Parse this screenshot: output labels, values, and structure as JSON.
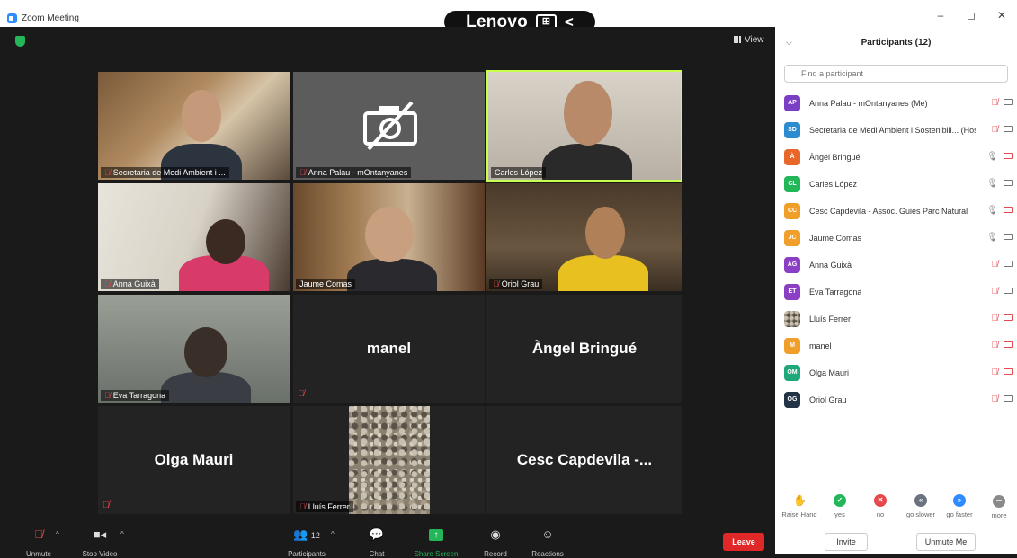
{
  "window": {
    "title": "Zoom Meeting",
    "controls": [
      "–",
      "◻",
      "✕"
    ]
  },
  "overlay": {
    "brand": "Lenovo",
    "grid_symbol": "⊞",
    "arrow": "<"
  },
  "meeting": {
    "view_label": "View",
    "tiles": [
      {
        "name": "Secretaria de Medi Ambient i ...",
        "muted": true,
        "kind": "video"
      },
      {
        "name": "Anna Palau - mOntanyanes",
        "muted": true,
        "kind": "camera-off"
      },
      {
        "name": "Carles López",
        "muted": false,
        "kind": "video",
        "active": true
      },
      {
        "name": "Anna Guixà",
        "muted": true,
        "kind": "video"
      },
      {
        "name": "Jaume Comas",
        "muted": false,
        "kind": "video"
      },
      {
        "name": "Oriol Grau",
        "muted": true,
        "kind": "video"
      },
      {
        "name": "Eva Tarragona",
        "muted": true,
        "kind": "video"
      },
      {
        "name": "manel",
        "muted": true,
        "kind": "name-only"
      },
      {
        "name": "Àngel Bringué",
        "muted": false,
        "kind": "name-only"
      },
      {
        "name": "Olga Mauri",
        "muted": true,
        "kind": "name-only"
      },
      {
        "name": "Lluís Ferrer",
        "muted": true,
        "kind": "image"
      },
      {
        "name": "Cesc Capdevila -...",
        "muted": false,
        "kind": "name-only"
      }
    ]
  },
  "toolbar": {
    "unmute": "Unmute",
    "stop_video": "Stop Video",
    "participants": "Participants",
    "participants_count": "12",
    "chat": "Chat",
    "share_screen": "Share Screen",
    "record": "Record",
    "reactions": "Reactions",
    "leave": "Leave"
  },
  "panel": {
    "title": "Participants (12)",
    "search_placeholder": "Find a participant",
    "participants": [
      {
        "initials": "AP",
        "name": "Anna Palau - mOntanyanes (Me)",
        "color": "#7b3fc4",
        "mic": "off",
        "cam": "on"
      },
      {
        "initials": "SD",
        "name": "Secretaria de Medi Ambient i Sostenibili... (Host)",
        "color": "#2d8ccf",
        "mic": "off",
        "cam": "on"
      },
      {
        "initials": "À",
        "name": "Àngel Bringué",
        "color": "#e8672a",
        "mic": "on",
        "cam": "off"
      },
      {
        "initials": "CL",
        "name": "Carles López",
        "color": "#23b75a",
        "mic": "on",
        "cam": "on"
      },
      {
        "initials": "CC",
        "name": "Cesc Capdevila - Assoc. Guies Parc Natural",
        "color": "#f0a02a",
        "mic": "on",
        "cam": "off"
      },
      {
        "initials": "JC",
        "name": "Jaume Comas",
        "color": "#f0a02a",
        "mic": "on",
        "cam": "on"
      },
      {
        "initials": "AG",
        "name": "Anna Guixà",
        "color": "#8b3fc4",
        "mic": "off",
        "cam": "on"
      },
      {
        "initials": "ET",
        "name": "Eva Tarragona",
        "color": "#8b3fc4",
        "mic": "off",
        "cam": "on"
      },
      {
        "initials": "",
        "name": "Lluís Ferrer",
        "color": "#9a9080",
        "mic": "off",
        "cam": "off"
      },
      {
        "initials": "M",
        "name": "manel",
        "color": "#f0a02a",
        "mic": "off",
        "cam": "off"
      },
      {
        "initials": "OM",
        "name": "Olga Mauri",
        "color": "#1fa87a",
        "mic": "off",
        "cam": "off"
      },
      {
        "initials": "OG",
        "name": "Oriol Grau",
        "color": "#243447",
        "mic": "off",
        "cam": "on"
      }
    ],
    "reactions": [
      {
        "label": "Raise Hand",
        "icon": "✋",
        "color": "#2d8cff"
      },
      {
        "label": "yes",
        "icon": "✓",
        "color": "#23b75a"
      },
      {
        "label": "no",
        "icon": "✕",
        "color": "#e5484d"
      },
      {
        "label": "go slower",
        "icon": "«",
        "color": "#6b7380"
      },
      {
        "label": "go faster",
        "icon": "»",
        "color": "#2d8cff"
      },
      {
        "label": "more",
        "icon": "•••",
        "color": "#8a8a8a"
      }
    ],
    "invite": "Invite",
    "unmute_me": "Unmute Me"
  }
}
